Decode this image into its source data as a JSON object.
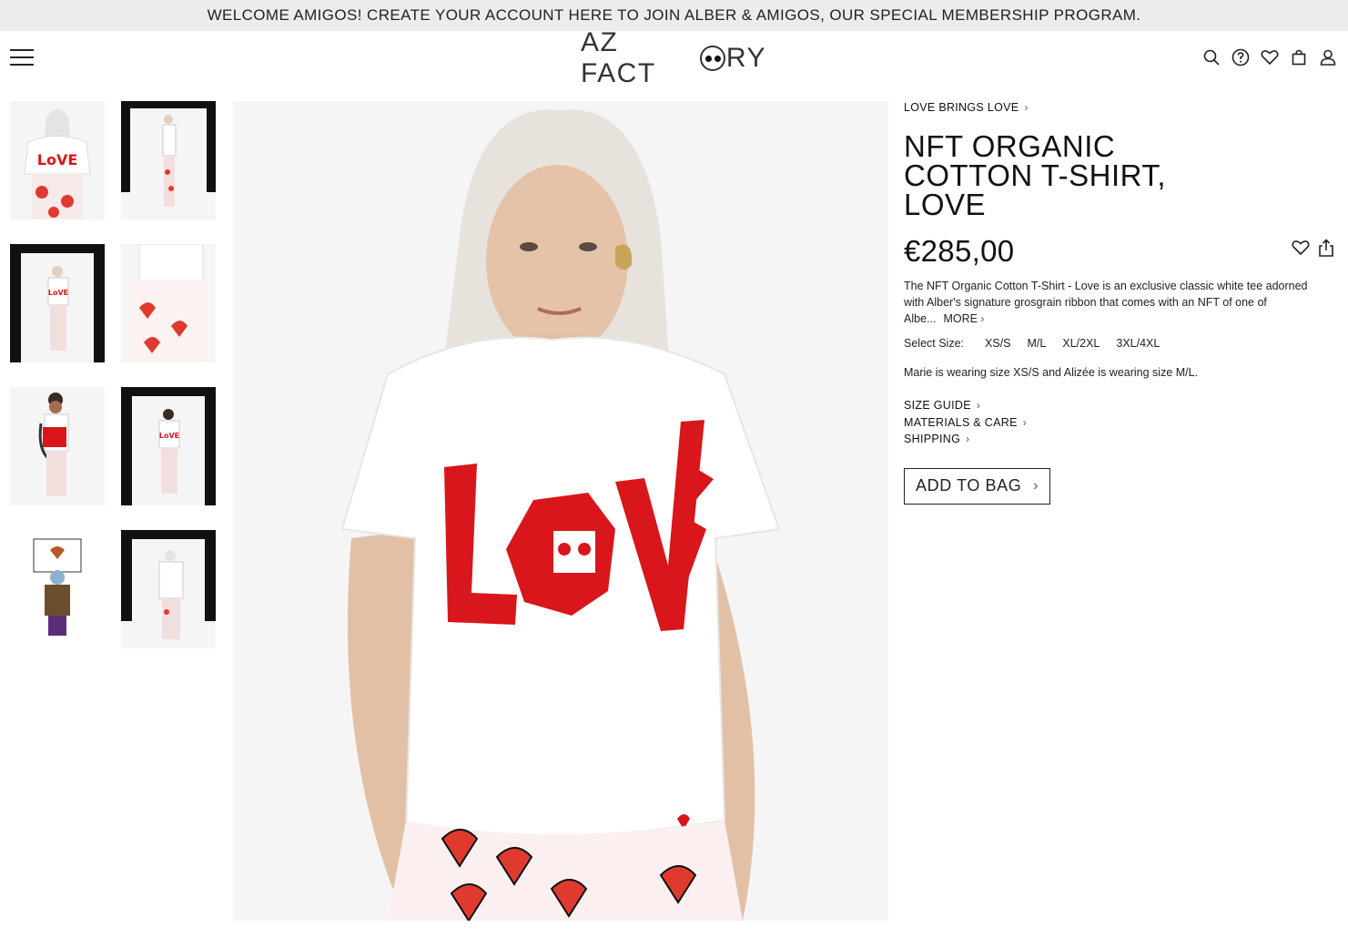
{
  "promo": {
    "text": "WELCOME AMIGOS! CREATE YOUR ACCOUNT HERE TO JOIN ALBER & AMIGOS, OUR SPECIAL MEMBERSHIP PROGRAM."
  },
  "header": {
    "logo_left": "AZ FACT",
    "logo_right": "RY",
    "icons": [
      "menu-icon",
      "search-icon",
      "help-icon",
      "heart-icon",
      "bag-icon",
      "account-icon"
    ]
  },
  "product": {
    "collection": "LOVE BRINGS LOVE",
    "title": "NFT ORGANIC COTTON T-SHIRT, LOVE",
    "price": "€285,00",
    "description": "The NFT Organic Cotton T-Shirt - Love is an exclusive classic white tee adorned with Alber's signature grosgrain ribbon that comes with an NFT of one of Albe...",
    "more_label": "MORE",
    "size_label": "Select Size:",
    "sizes": [
      "XS/S",
      "M/L",
      "XL/2XL",
      "3XL/4XL"
    ],
    "wearing_note": "Marie is wearing size XS/S and Alizée is wearing size M/L.",
    "links": [
      "SIZE GUIDE",
      "MATERIALS & CARE",
      "SHIPPING"
    ],
    "add_to_bag": "ADD TO BAG",
    "shirt_graphic_text": "LOVE"
  },
  "colors": {
    "accent_red": "#d8161b",
    "promo_bg": "#ececec",
    "text": "#111111"
  }
}
